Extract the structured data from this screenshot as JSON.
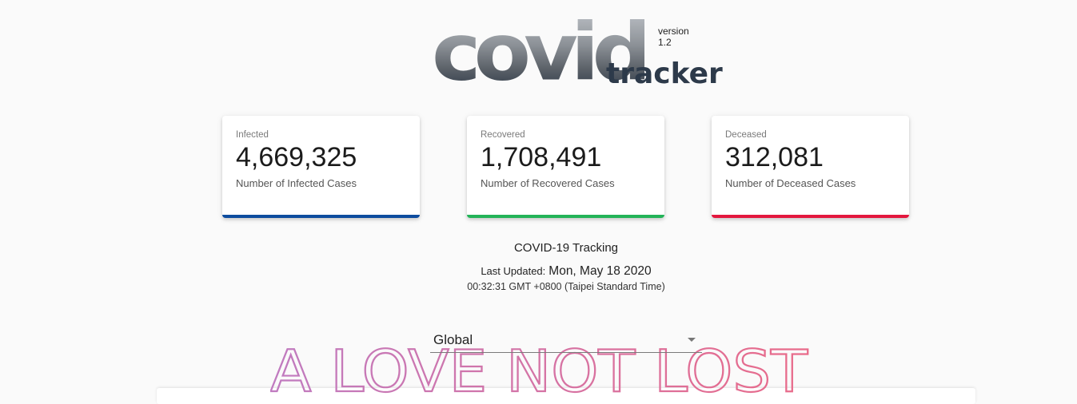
{
  "logo": {
    "main": "covid",
    "sub": "tracker",
    "version": "version 1.2"
  },
  "cards": [
    {
      "label": "Infected",
      "value": "4,669,325",
      "desc": "Number of Infected Cases",
      "color": "#0d4c9e"
    },
    {
      "label": "Recovered",
      "value": "1,708,491",
      "desc": "Number of Recovered Cases",
      "color": "#23b358"
    },
    {
      "label": "Deceased",
      "value": "312,081",
      "desc": "Number of Deceased Cases",
      "color": "#e3173e"
    }
  ],
  "tracking_title": "COVID-19 Tracking",
  "last_updated": {
    "label": "Last Updated:",
    "date": "Mon, May 18 2020",
    "time": "00:32:31 GMT +0800 (Taipei Standard Time)"
  },
  "country_select": {
    "value": "Global",
    "icon": "chevron-down-icon"
  },
  "banner": {
    "text": "A LOVE NOT LOST",
    "gradient": [
      "#c07bc0",
      "#e96b8a"
    ]
  }
}
